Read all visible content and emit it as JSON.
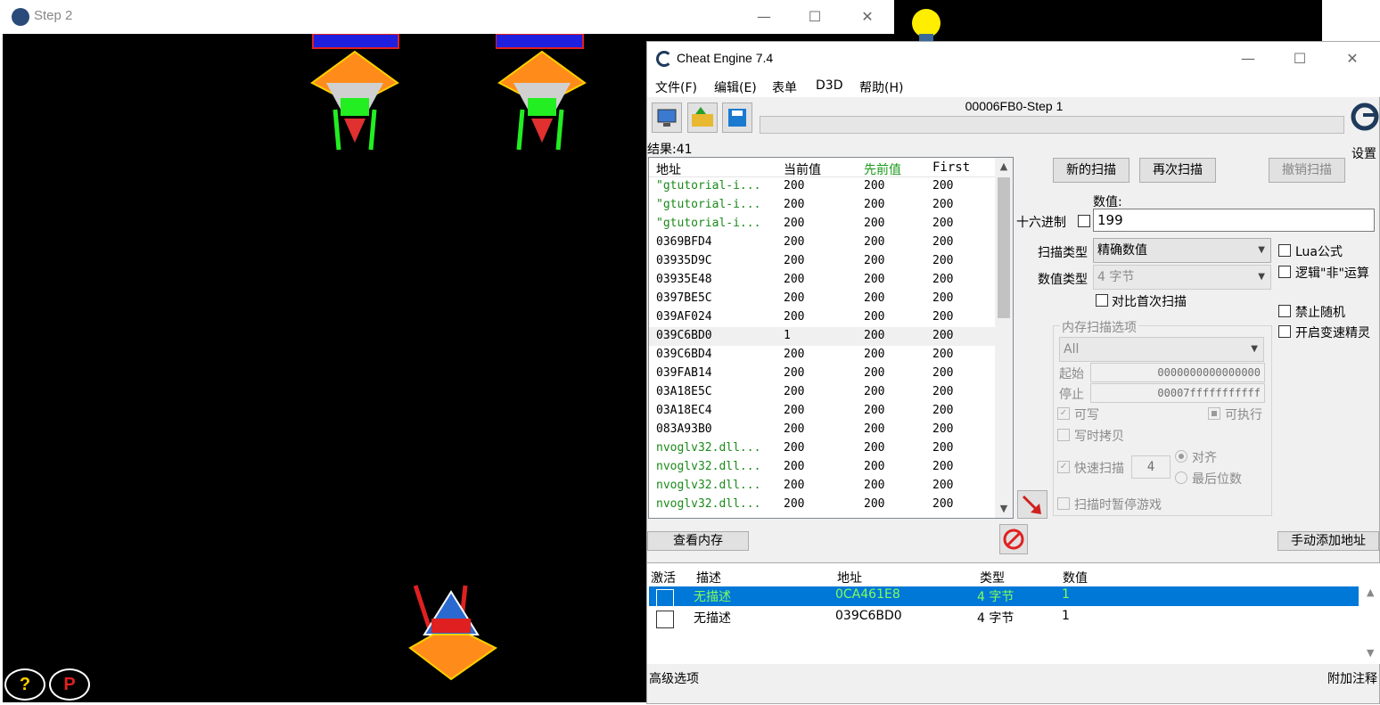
{
  "game": {
    "title": "Step 2",
    "hud_help": "?",
    "hud_pause": "P"
  },
  "ce": {
    "title": "Cheat Engine 7.4",
    "menu": [
      "文件(F)",
      "编辑(E)",
      "表单",
      "D3D",
      "帮助(H)"
    ],
    "process_title": "00006FB0-Step 1",
    "settings_label": "设置",
    "result_count": "结果:41",
    "columns": {
      "address": "地址",
      "current": "当前值",
      "previous": "先前值",
      "first": "First"
    },
    "rows": [
      {
        "address": "\"gtutorial-i...",
        "current": "200",
        "previous": "200",
        "first": "200",
        "green": true
      },
      {
        "address": "\"gtutorial-i...",
        "current": "200",
        "previous": "200",
        "first": "200",
        "green": true
      },
      {
        "address": "\"gtutorial-i...",
        "current": "200",
        "previous": "200",
        "first": "200",
        "green": true
      },
      {
        "address": "0369BFD4",
        "current": "200",
        "previous": "200",
        "first": "200",
        "green": false
      },
      {
        "address": "03935D9C",
        "current": "200",
        "previous": "200",
        "first": "200",
        "green": false
      },
      {
        "address": "03935E48",
        "current": "200",
        "previous": "200",
        "first": "200",
        "green": false
      },
      {
        "address": "0397BE5C",
        "current": "200",
        "previous": "200",
        "first": "200",
        "green": false
      },
      {
        "address": "039AF024",
        "current": "200",
        "previous": "200",
        "first": "200",
        "green": false
      },
      {
        "address": "039C6BD0",
        "current": "1",
        "previous": "200",
        "first": "200",
        "green": false
      },
      {
        "address": "039C6BD4",
        "current": "200",
        "previous": "200",
        "first": "200",
        "green": false
      },
      {
        "address": "039FAB14",
        "current": "200",
        "previous": "200",
        "first": "200",
        "green": false
      },
      {
        "address": "03A18E5C",
        "current": "200",
        "previous": "200",
        "first": "200",
        "green": false
      },
      {
        "address": "03A18EC4",
        "current": "200",
        "previous": "200",
        "first": "200",
        "green": false
      },
      {
        "address": "083A93B0",
        "current": "200",
        "previous": "200",
        "first": "200",
        "green": false
      },
      {
        "address": "nvoglv32.dll...",
        "current": "200",
        "previous": "200",
        "first": "200",
        "green": true
      },
      {
        "address": "nvoglv32.dll...",
        "current": "200",
        "previous": "200",
        "first": "200",
        "green": true
      },
      {
        "address": "nvoglv32.dll...",
        "current": "200",
        "previous": "200",
        "first": "200",
        "green": true
      },
      {
        "address": "nvoglv32.dll...",
        "current": "200",
        "previous": "200",
        "first": "200",
        "green": true
      }
    ],
    "buttons": {
      "new_scan": "新的扫描",
      "next_scan": "再次扫描",
      "undo_scan": "撤销扫描",
      "view_memory": "查看内存",
      "add_address": "手动添加地址"
    },
    "value_label": "数值:",
    "hex_label": "十六进制",
    "value": "199",
    "scan_type_label": "扫描类型",
    "scan_type": "精确数值",
    "value_type_label": "数值类型",
    "value_type": "4 字节",
    "compare_first": "对比首次扫描",
    "lua_formula": "Lua公式",
    "logic_not": "逻辑\"非\"运算",
    "no_random": "禁止随机",
    "speedhack": "开启变速精灵",
    "mem_options": {
      "title": "内存扫描选项",
      "region": "All",
      "start_label": "起始",
      "start": "0000000000000000",
      "stop_label": "停止",
      "stop": "00007fffffffffff",
      "writable": "可写",
      "executable": "可执行",
      "copy_on_write": "写时拷贝",
      "fast_scan": "快速扫描",
      "fast_scan_value": "4",
      "align": "对齐",
      "last_digits": "最后位数",
      "pause_game": "扫描时暂停游戏"
    },
    "addr_columns": {
      "active": "激活",
      "desc": "描述",
      "address": "地址",
      "type": "类型",
      "value": "数值"
    },
    "addr_rows": [
      {
        "desc": "无描述",
        "address": "0CA461E8",
        "type": "4 字节",
        "value": "1"
      },
      {
        "desc": "无描述",
        "address": "039C6BD0",
        "type": "4 字节",
        "value": "1"
      }
    ],
    "footer_left": "高级选项",
    "footer_right": "附加注释"
  }
}
